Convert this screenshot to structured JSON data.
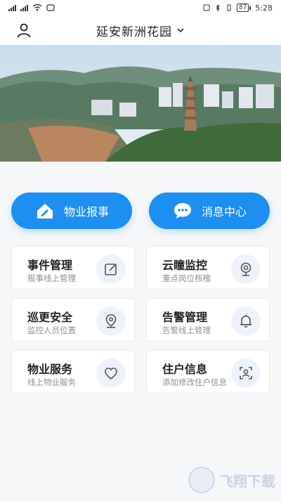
{
  "status_bar": {
    "time": "5:28",
    "battery": "87"
  },
  "header": {
    "title": "延安新洲花园"
  },
  "actions": [
    {
      "label": "物业报事",
      "icon": "home-report-icon"
    },
    {
      "label": "消息中心",
      "icon": "message-icon"
    }
  ],
  "cards": [
    {
      "title": "事件管理",
      "subtitle": "报事线上管理",
      "icon": "edit-icon"
    },
    {
      "title": "云瞳监控",
      "subtitle": "重点岗位核稽",
      "icon": "camera-icon"
    },
    {
      "title": "巡更安全",
      "subtitle": "监控人员位置",
      "icon": "location-pin-icon"
    },
    {
      "title": "告警管理",
      "subtitle": "告警线上管理",
      "icon": "bell-icon"
    },
    {
      "title": "物业服务",
      "subtitle": "线上物业服务",
      "icon": "heart-icon"
    },
    {
      "title": "住户信息",
      "subtitle": "添加修改住户信息",
      "icon": "face-scan-icon"
    }
  ],
  "watermark": {
    "text": "飞翔下载"
  },
  "colors": {
    "accent": "#1f8ef1",
    "icon_bg": "#eef3fb",
    "page_bg": "#f6f7f9"
  }
}
